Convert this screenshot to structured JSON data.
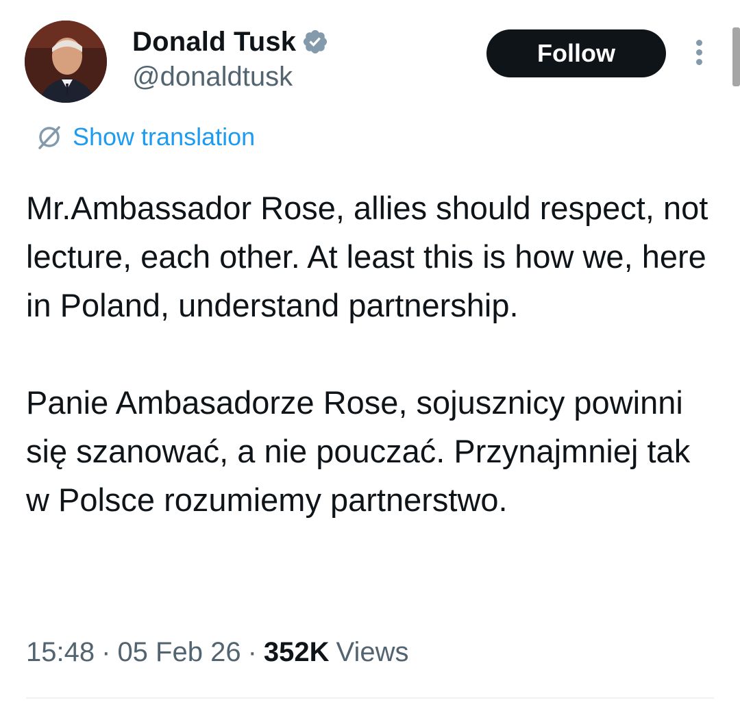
{
  "author": {
    "name": "Donald Tusk",
    "handle": "@donaldtusk",
    "verified_icon": "verified-badge-icon",
    "avatar_icon": "avatar"
  },
  "actions": {
    "follow_label": "Follow",
    "more_icon": "more-vertical-icon"
  },
  "translate": {
    "icon": "translate-globe-icon",
    "label": "Show translation"
  },
  "tweet": {
    "text": "Mr.Ambassador Rose, allies should respect, not lecture, each other. At least this is how we, here in Poland, understand partnership.\n\nPanie Ambasadorze Rose, sojusznicy powinni się szanować, a nie pouczać. Przynajmniej tak w Polsce rozumiemy partnerstwo."
  },
  "meta": {
    "time": "15:48",
    "date": "05 Feb 26",
    "views_count": "352K",
    "views_label": "Views",
    "separator": "·"
  },
  "colors": {
    "accent": "#1d9bf0",
    "text_primary": "#0f1419",
    "text_secondary": "#536471",
    "button_bg": "#0f1419"
  }
}
